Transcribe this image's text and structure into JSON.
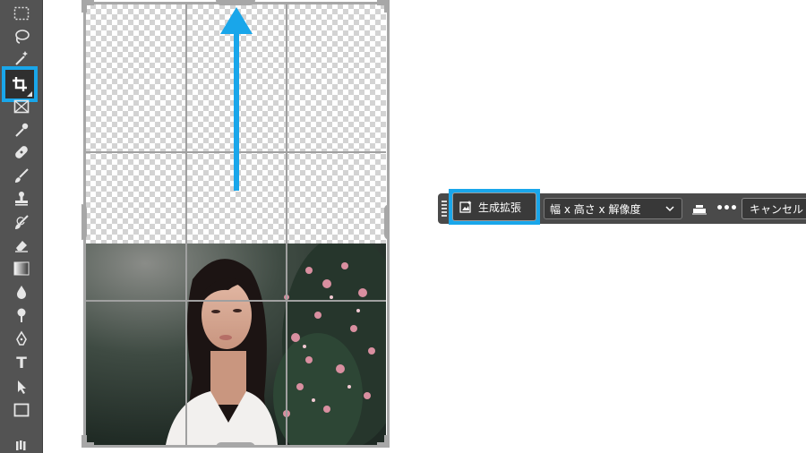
{
  "toolbar": {
    "tools": [
      {
        "name": "rectangular-marquee-tool"
      },
      {
        "name": "lasso-tool"
      },
      {
        "name": "magic-wand-tool"
      },
      {
        "name": "crop-tool",
        "selected": true
      },
      {
        "name": "frame-tool"
      },
      {
        "name": "eyedropper-tool"
      },
      {
        "name": "healing-brush-tool"
      },
      {
        "name": "brush-tool"
      },
      {
        "name": "clone-stamp-tool"
      },
      {
        "name": "history-brush-tool"
      },
      {
        "name": "eraser-tool"
      },
      {
        "name": "gradient-tool"
      },
      {
        "name": "blur-tool"
      },
      {
        "name": "dodge-tool"
      },
      {
        "name": "pen-tool"
      },
      {
        "name": "type-tool",
        "label": "T"
      },
      {
        "name": "path-selection-tool"
      },
      {
        "name": "rectangle-tool"
      },
      {
        "name": "hand-tool"
      }
    ]
  },
  "taskbar": {
    "generate_label": "生成拡張",
    "ratio_value": "幅 x 高さ x 解像度",
    "more_label": "•••",
    "cancel_label": "キャンセル"
  },
  "colors": {
    "accent": "#19a6ea",
    "toolbar_bg": "#535353",
    "taskbar_bg": "#4a4a4a"
  }
}
